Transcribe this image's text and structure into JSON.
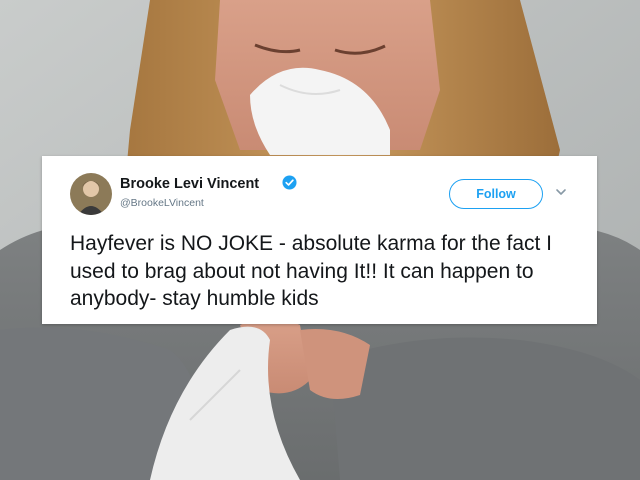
{
  "tweet": {
    "display_name": "Brooke Levi Vincent",
    "handle": "@BrookeLVincent",
    "follow_label": "Follow",
    "text": "Hayfever is NO JOKE - absolute karma for the fact I used to brag about not having It!! It can happen to anybody- stay humble kids"
  },
  "colors": {
    "accent": "#1da1f2",
    "name_text": "#14171a",
    "handle_text": "#657786"
  },
  "icons": {
    "verified": "verified-badge-icon",
    "more": "chevron-down-icon"
  }
}
